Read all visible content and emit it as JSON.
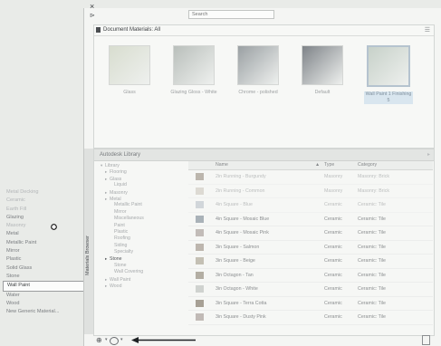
{
  "background_list": {
    "items": [
      {
        "label": "Metal Decking",
        "faded": true
      },
      {
        "label": "Ceramic",
        "faded": true
      },
      {
        "label": "Earth Fill",
        "faded": true
      },
      {
        "label": "Glazing",
        "faded": false
      },
      {
        "label": "Masonry",
        "faded": true
      },
      {
        "label": "Metal",
        "faded": false
      },
      {
        "label": "Metallic Paint",
        "faded": false
      },
      {
        "label": "Mirror",
        "faded": false
      },
      {
        "label": "Plastic",
        "faded": false
      },
      {
        "label": "Solid Glass",
        "faded": false
      },
      {
        "label": "Stone",
        "faded": false
      },
      {
        "label": "Wall Paint",
        "faded": false,
        "selected": true
      },
      {
        "label": "Water",
        "faded": false
      },
      {
        "label": "Wood",
        "faded": false
      },
      {
        "label": "New Generic Material...",
        "faded": false
      }
    ]
  },
  "browser": {
    "close_label": "×",
    "pin_label": "⊳",
    "search_placeholder": "Search",
    "side_tab_label": "Materials Browser",
    "document_panel": {
      "title": "Document Materials: All",
      "expand_icon": "☰",
      "swatches": [
        {
          "label": "Glass",
          "color": "#d8ddcf",
          "selected": false
        },
        {
          "label": "Glazing Gloss - White",
          "color": "#b9bfbb",
          "selected": false
        },
        {
          "label": "Chrome - polished",
          "color": "#9aa0a3",
          "selected": false
        },
        {
          "label": "Default",
          "color": "#7e8388",
          "selected": false
        },
        {
          "label": "Wall Paint 1 Finishing 5",
          "color": "#c7d1c9",
          "selected": true
        }
      ]
    },
    "library_panel": {
      "title": "Autodesk Library",
      "resize_icon": "▸",
      "tree": [
        {
          "label": "Library",
          "indent": 1,
          "toggle": "▾",
          "dark": false
        },
        {
          "label": "Flooring",
          "indent": 2,
          "toggle": "▸",
          "dark": false
        },
        {
          "label": "Glass",
          "indent": 2,
          "toggle": "▸",
          "dark": false
        },
        {
          "label": "Liquid",
          "indent": 3,
          "toggle": "",
          "dark": false
        },
        {
          "label": "Masonry",
          "indent": 2,
          "toggle": "▸",
          "dark": false
        },
        {
          "label": "Metal",
          "indent": 2,
          "toggle": "▸",
          "dark": false
        },
        {
          "label": "Metallic Paint",
          "indent": 3,
          "toggle": "",
          "dark": false
        },
        {
          "label": "Mirror",
          "indent": 3,
          "toggle": "",
          "dark": false
        },
        {
          "label": "Miscellaneous",
          "indent": 3,
          "toggle": "",
          "dark": false
        },
        {
          "label": "Paint",
          "indent": 3,
          "toggle": "",
          "dark": false
        },
        {
          "label": "Plastic",
          "indent": 3,
          "toggle": "",
          "dark": false
        },
        {
          "label": "Roofing",
          "indent": 3,
          "toggle": "",
          "dark": false
        },
        {
          "label": "Siding",
          "indent": 3,
          "toggle": "",
          "dark": false
        },
        {
          "label": "Specialty",
          "indent": 3,
          "toggle": "",
          "dark": false
        },
        {
          "label": "Stone",
          "indent": 2,
          "toggle": "▸",
          "dark": true
        },
        {
          "label": "Stone",
          "indent": 3,
          "toggle": "",
          "dark": false
        },
        {
          "label": "Wall Covering",
          "indent": 3,
          "toggle": "",
          "dark": false
        },
        {
          "label": "Wall Paint",
          "indent": 2,
          "toggle": "▸",
          "dark": false
        },
        {
          "label": "Wood",
          "indent": 2,
          "toggle": "▸",
          "dark": false
        }
      ],
      "columns": [
        "Name",
        "Type",
        "Category"
      ],
      "sort_indicator": "▲",
      "rows": [
        {
          "name": "2in Running - Burgundy",
          "type": "Masonry",
          "category": "Masonry: Brick",
          "thumb": "#8d8173",
          "faded": true
        },
        {
          "name": "2in Running - Common",
          "type": "Masonry",
          "category": "Masonry: Brick",
          "thumb": "#c9c3b8",
          "faded": true
        },
        {
          "name": "4in Square - Blue",
          "type": "Ceramic",
          "category": "Ceramic: Tile",
          "thumb": "#b4bcc4",
          "faded": true
        },
        {
          "name": "4in Square - Mosaic Blue",
          "type": "Ceramic",
          "category": "Ceramic: Tile",
          "thumb": "#a9b2b8",
          "faded": false
        },
        {
          "name": "4in Square - Mosaic Pink",
          "type": "Ceramic",
          "category": "Ceramic: Tile",
          "thumb": "#c2bcb8",
          "faded": false
        },
        {
          "name": "3in Square - Salmon",
          "type": "Ceramic",
          "category": "Ceramic: Tile",
          "thumb": "#bdb6ae",
          "faded": false
        },
        {
          "name": "3in Square - Beige",
          "type": "Ceramic",
          "category": "Ceramic: Tile",
          "thumb": "#c4c0b4",
          "faded": false
        },
        {
          "name": "3in Octagon - Tan",
          "type": "Ceramic",
          "category": "Ceramic: Tile",
          "thumb": "#b3aea3",
          "faded": false
        },
        {
          "name": "3in Octagon - White",
          "type": "Ceramic",
          "category": "Ceramic: Tile",
          "thumb": "#cfd2cf",
          "faded": false
        },
        {
          "name": "3in Square - Terra Cotta",
          "type": "Ceramic",
          "category": "Ceramic: Tile",
          "thumb": "#a7a095",
          "faded": false
        },
        {
          "name": "3in Square - Dusty Pink",
          "type": "Ceramic",
          "category": "Ceramic: Tile",
          "thumb": "#c1bab6",
          "faded": false
        }
      ]
    },
    "bottom_bar": {
      "add_label": "⊕",
      "caret_label": "▾",
      "scroll_label": ""
    }
  }
}
